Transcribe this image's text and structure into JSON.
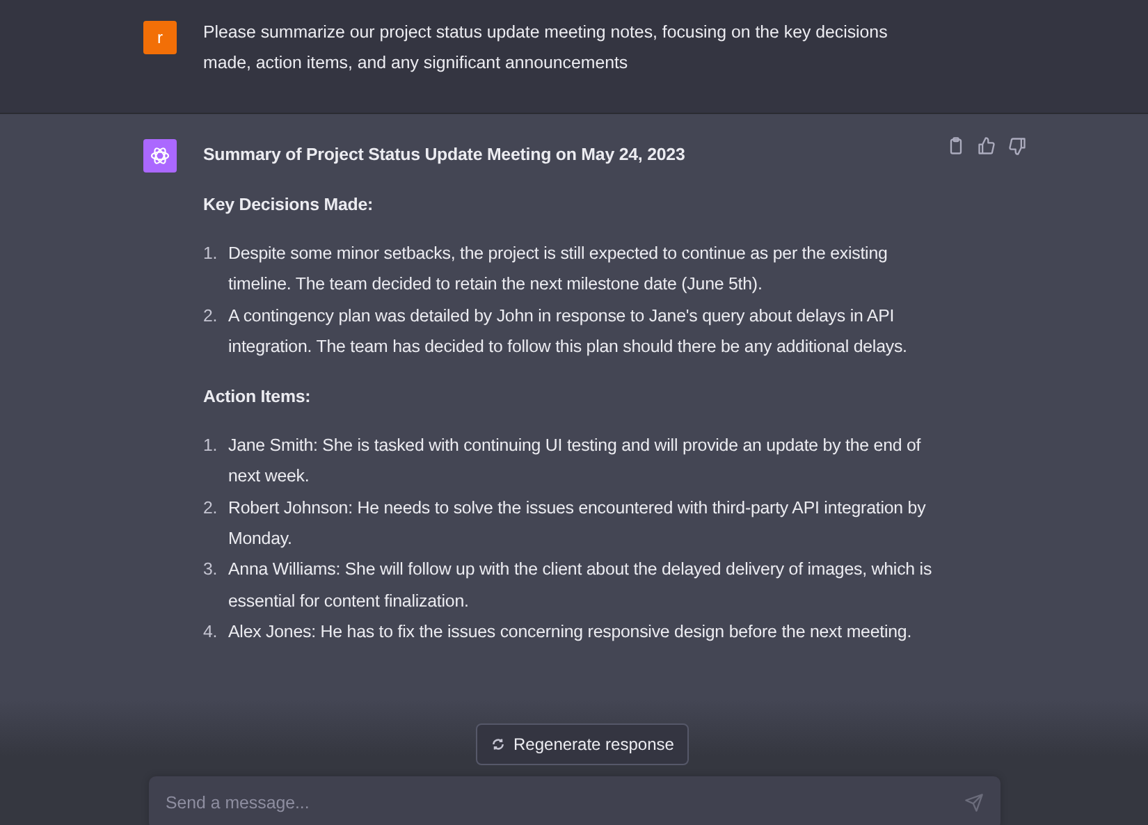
{
  "user_message": {
    "avatar_letter": "r",
    "text": "Please summarize our project status update meeting notes, focusing on the key decisions made, action items, and any significant announcements"
  },
  "assistant_message": {
    "title": "Summary of Project Status Update Meeting on May 24, 2023",
    "sections": [
      {
        "heading": "Key Decisions Made:",
        "items": [
          {
            "number": "1.",
            "text": "Despite some minor setbacks, the project is still expected to continue as per the existing timeline. The team decided to retain the next milestone date (June 5th)."
          },
          {
            "number": "2.",
            "text": "A contingency plan was detailed by John in response to Jane's query about delays in API integration. The team has decided to follow this plan should there be any additional delays."
          }
        ]
      },
      {
        "heading": "Action Items:",
        "items": [
          {
            "number": "1.",
            "text": "Jane Smith: She is tasked with continuing UI testing and will provide an update by the end of next week."
          },
          {
            "number": "2.",
            "text": "Robert Johnson: He needs to solve the issues encountered with third-party API integration by Monday."
          },
          {
            "number": "3.",
            "text": "Anna Williams: She will follow up with the client about the delayed delivery of images, which is essential for content finalization."
          },
          {
            "number": "4.",
            "text": "Alex Jones: He has to fix the issues concerning responsive design before the next meeting."
          }
        ]
      }
    ]
  },
  "regenerate_button": {
    "label": "Regenerate response"
  },
  "composer": {
    "placeholder": "Send a message..."
  }
}
